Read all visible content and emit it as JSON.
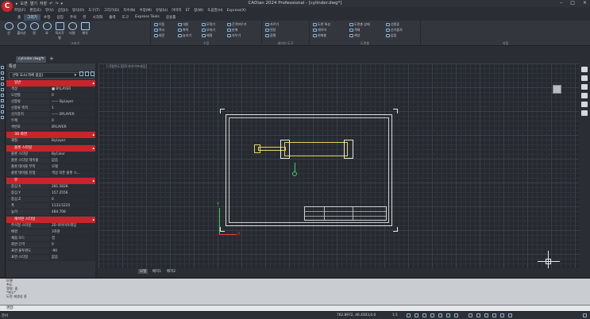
{
  "window": {
    "title": "CADian 2024 Professional - [cylinder.dwg*]"
  },
  "app": {
    "logo": "C"
  },
  "qat": {
    "items": [
      "▸",
      "도면",
      "열기",
      "저장",
      "↶",
      "↷",
      "▾"
    ]
  },
  "menu": {
    "items": [
      "파일(F)",
      "편집(E)",
      "뷰(V)",
      "삽입(I)",
      "형식(O)",
      "도구(T)",
      "그리기(D)",
      "치수(N)",
      "수정(M)",
      "유틸(U)",
      "이미지",
      "ET",
      "창(W)",
      "도움말(H)",
      "Express(X)"
    ]
  },
  "ribbon_tabs": {
    "items": [
      "홈",
      "그리기",
      "수정",
      "삽입",
      "주석",
      "뷰",
      "시각화",
      "출력",
      "도구",
      "Express Tools",
      "응용툴"
    ],
    "active": 1
  },
  "ribbon": {
    "groups": [
      "그리기",
      "수정",
      "레이어 도구",
      "도면층",
      "지정"
    ],
    "draw_tools": [
      "선",
      "폴리선",
      "원",
      "호",
      "직사각형",
      "타원",
      "해치"
    ],
    "modify_items": [
      "이동",
      "복사",
      "회전",
      "대칭",
      "축척",
      "늘리기",
      "모깎기",
      "모따기",
      "배열",
      "간격띄우기",
      "분해",
      "지우기",
      "자르기",
      "연장",
      "정렬"
    ],
    "right_items": [
      "도면 특성",
      "레이어",
      "현재층",
      "도면층 상태",
      "객체",
      "색상",
      "선종류",
      "선가중치",
      "없음"
    ]
  },
  "doctab": {
    "label": "cylinder.dwg*",
    "close": "×",
    "add": "+"
  },
  "properties": {
    "title": "특성",
    "selection": "선택 요소(객체 없음)",
    "sections": [
      {
        "name": "일반",
        "rows": [
          [
            "색상",
            "■ BYLAYER"
          ],
          [
            "도면층",
            "0"
          ],
          [
            "선종류",
            "—— ByLayer"
          ],
          [
            "선종류 축척",
            "1"
          ],
          [
            "선가중치",
            "—— BYLAYER"
          ],
          [
            "두께",
            "0"
          ],
          [
            "색번호",
            "BYLAYER"
          ]
        ]
      },
      {
        "name": "3D 화면",
        "rows": [
          [
            "재질",
            "ByLayer"
          ]
        ]
      },
      {
        "name": "플롯 스타일",
        "rows": [
          [
            "플롯 스타일",
            "ByColor"
          ],
          [
            "플롯 스타일 테이블",
            "없음"
          ],
          [
            "플롯 테이블 부착",
            "모델"
          ],
          [
            "플롯 테이블 유형",
            "색상 의존 플롯 스..."
          ]
        ]
      },
      {
        "name": "뷰",
        "rows": [
          [
            "중심 X",
            "281.5828"
          ],
          [
            "중심 Y",
            "157.2556"
          ],
          [
            "중심 Z",
            "0"
          ],
          [
            "폭",
            "1133.5225"
          ],
          [
            "높이",
            "484.708"
          ]
        ]
      },
      {
        "name": "해석된 스타일",
        "rows": [
          [
            "주석형 스타일",
            "2D 와이어프레임"
          ],
          [
            "배경",
            "3차원"
          ],
          [
            "채움 모드",
            "켬"
          ],
          [
            "화면 간격",
            "0"
          ],
          [
            "표면 불투명도",
            "-90"
          ],
          [
            "표면 스타일",
            "없음"
          ]
        ]
      }
    ]
  },
  "viewport": {
    "label": "[-][평면도][2D 와이어프레임]"
  },
  "ucs": {
    "y": "Y",
    "x": "X"
  },
  "layout_tabs": {
    "items": [
      "모델",
      "배치1",
      "배치2"
    ],
    "active": 0
  },
  "command": {
    "history": [
      "모델",
      "취소",
      "명령: 줌",
      "*취소*",
      "도면 재생성 중"
    ],
    "prompt": "명령:"
  },
  "status": {
    "left": "준비",
    "coords": "762.8972, 46.4303,0.0",
    "scale": "1:1"
  }
}
